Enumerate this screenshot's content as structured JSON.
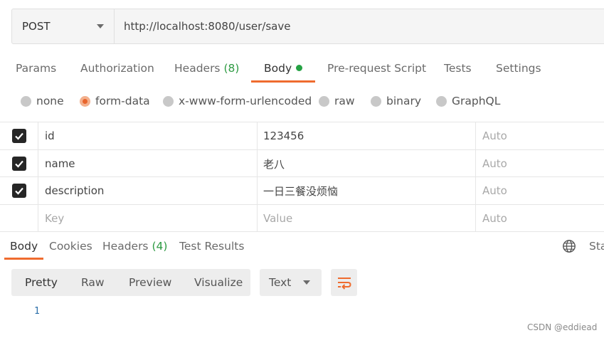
{
  "request": {
    "method": "POST",
    "url": "http://localhost:8080/user/save"
  },
  "request_tabs": {
    "params": "Params",
    "authorization": "Authorization",
    "headers": "Headers",
    "headers_count": "(8)",
    "body": "Body",
    "prerequest": "Pre-request Script",
    "tests": "Tests",
    "settings": "Settings",
    "active": "Body"
  },
  "body_types": {
    "none": "none",
    "form_data": "form-data",
    "urlencoded": "x-www-form-urlencoded",
    "raw": "raw",
    "binary": "binary",
    "graphql": "GraphQL",
    "selected": "form-data"
  },
  "params": {
    "rows": [
      {
        "checked": true,
        "key": "id",
        "value": "123456",
        "type": "Auto"
      },
      {
        "checked": true,
        "key": "name",
        "value": "老八",
        "type": "Auto"
      },
      {
        "checked": true,
        "key": "description",
        "value": "一日三餐没烦恼",
        "type": "Auto"
      }
    ],
    "empty_row": {
      "key_placeholder": "Key",
      "value_placeholder": "Value",
      "type": "Auto"
    }
  },
  "response_tabs": {
    "body": "Body",
    "cookies": "Cookies",
    "headers": "Headers",
    "headers_count": "(4)",
    "test_results": "Test Results",
    "status_truncated": "Sta",
    "active": "Body"
  },
  "response_toolbar": {
    "pretty": "Pretty",
    "raw": "Raw",
    "preview": "Preview",
    "visualize": "Visualize",
    "active": "Pretty",
    "format": "Text"
  },
  "response_body": {
    "line_numbers": [
      "1"
    ]
  },
  "watermark": "CSDN @eddiead",
  "colors": {
    "accent": "#ef6c2f",
    "count_green": "#2e9b43",
    "body_dot": "#25a244"
  },
  "icons": {
    "wrap": "wrap-lines-icon",
    "globe": "globe-icon",
    "method_caret": "chevron-down-icon"
  }
}
